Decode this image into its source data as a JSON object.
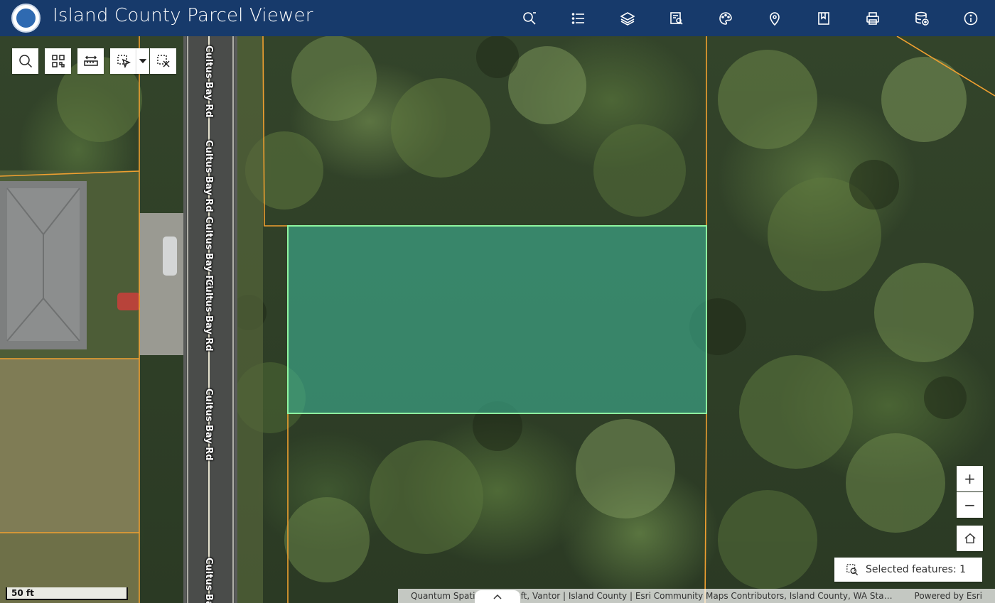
{
  "header": {
    "title": "Island County Parcel Viewer",
    "logo_icon": "island-county-seal",
    "icons": [
      "search-icon",
      "list-icon",
      "layers-icon",
      "query-icon",
      "basemap-icon",
      "location-icon",
      "bookmark-icon",
      "print-icon",
      "add-data-icon",
      "info-icon"
    ]
  },
  "toolbar": {
    "icons": [
      "search-icon",
      "qr-select-icon",
      "measure-icon",
      "select-icon",
      "dropdown-caret-icon",
      "clear-selection-icon"
    ]
  },
  "map": {
    "road_labels": [
      "Cultus Bay Rd",
      "Cultus Bay Rd",
      "Cultus Bay Rd",
      "Cultus Bay Rd",
      "Cultus Bay Rd",
      "Cultus Ba"
    ],
    "colors": {
      "header_bg": "#173a6b",
      "parcel_line": "#f0a030",
      "selection_fill": "#3fbfa0",
      "selection_outline": "#8ef5a0"
    }
  },
  "zoom": {
    "in_label": "+",
    "out_label": "−",
    "home_icon": "home-icon"
  },
  "selection": {
    "label": "Selected features: 1"
  },
  "scalebar": {
    "label": "50 ft"
  },
  "attribution": {
    "text": "Quantum Spatial, Microsoft, Vantor | Island County | Esri Community Maps Contributors, Island County, WA Sta…",
    "powered": "Powered by Esri"
  }
}
